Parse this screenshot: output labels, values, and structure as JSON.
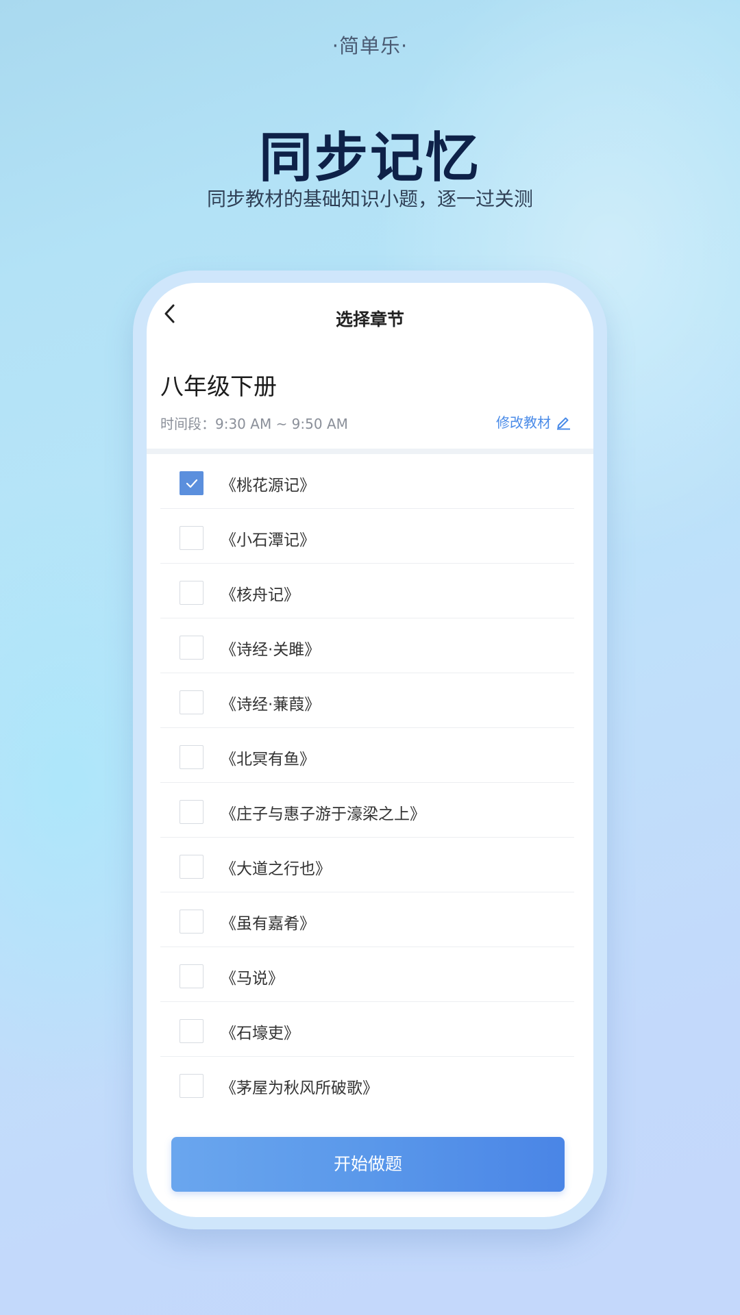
{
  "hero": {
    "tagline": "·简单乐·",
    "headline": "同步记忆",
    "subline": "同步教材的基础知识小题，逐一过关测"
  },
  "screen": {
    "title": "选择章节",
    "back_icon": "chevron-left-icon",
    "book_title": "八年级下册",
    "time_label": "时间段：9:30 AM ~ 9:50 AM",
    "edit_label": "修改教材",
    "edit_icon": "pencil-icon",
    "chapters": [
      {
        "label": "《桃花源记》",
        "checked": true
      },
      {
        "label": "《小石潭记》",
        "checked": false
      },
      {
        "label": "《核舟记》",
        "checked": false
      },
      {
        "label": "《诗经·关雎》",
        "checked": false
      },
      {
        "label": "《诗经·蒹葭》",
        "checked": false
      },
      {
        "label": "《北冥有鱼》",
        "checked": false
      },
      {
        "label": "《庄子与惠子游于濠梁之上》",
        "checked": false
      },
      {
        "label": "《大道之行也》",
        "checked": false
      },
      {
        "label": "《虽有嘉肴》",
        "checked": false
      },
      {
        "label": "《马说》",
        "checked": false
      },
      {
        "label": "《石壕吏》",
        "checked": false
      },
      {
        "label": "《茅屋为秋风所破歌》",
        "checked": false
      }
    ],
    "start_label": "开始做题"
  },
  "colors": {
    "accent": "#4a8be8",
    "checkbox_checked": "#5b8fdd",
    "headline": "#0e2148"
  }
}
